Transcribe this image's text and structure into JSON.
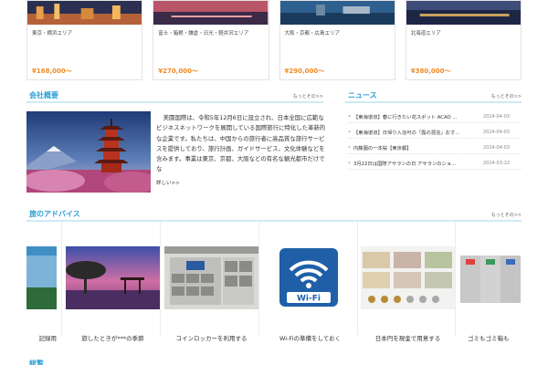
{
  "tours": [
    {
      "area": "東京・横浜エリア",
      "price": "¥168,000～"
    },
    {
      "area": "富士・箱根・鎌倉・日光・軽井沢エリア",
      "price": "¥270,000～"
    },
    {
      "area": "大阪・京都・広島エリア",
      "price": "¥290,000～"
    },
    {
      "area": "北海道エリア",
      "price": "¥380,000～"
    }
  ],
  "company": {
    "title": "会社概要",
    "more": "もっとその>>",
    "text": "美園国際は、令和5年12月6日に設立され、日本全国に広範なビジネスネットワークを展開している国際旅行に特化した革新的な企業です。私たちは、中国からの旅行者に高品質な旅行サービスを提供しており、旅行計画、ガイドサービス、文化体験などを含みます。事業は東京、京都、大阪などの有名な観光都市だけでな",
    "details_link": "詳しい>>"
  },
  "news": {
    "title": "ニュース",
    "more": "もっとその>>",
    "items": [
      {
        "title": "【東海道旧】春に行きたい花スポット ACAO ...",
        "date": "2024-04-03"
      },
      {
        "title": "【東海道旧】日帰り入浴可の「露の混浴」おす...",
        "date": "2024-04-03"
      },
      {
        "title": "内藤園の一本桜【東京都】",
        "date": "2024-04-03"
      },
      {
        "title": "3月22日は国際アサランの日 アサランのショ...",
        "date": "2024-03-22"
      }
    ]
  },
  "advice": {
    "title": "旅のアドバイス",
    "more": "もっとその>>",
    "items": [
      {
        "caption": "記録用"
      },
      {
        "caption": "旅したときが***の季節"
      },
      {
        "caption": "コインロッカーを利用する"
      },
      {
        "caption": "Wi-Fiの準備をしておく"
      },
      {
        "caption": "日本円を現金で用意する"
      },
      {
        "caption": "ゴミもゴミ箱も"
      }
    ]
  },
  "bottom_section": {
    "title": "総覧"
  },
  "icons": [
    "wifi-icon"
  ],
  "colors": {
    "accent": "#2a9fd6",
    "price": "#f08a24",
    "divider": "#cfeaf4"
  }
}
